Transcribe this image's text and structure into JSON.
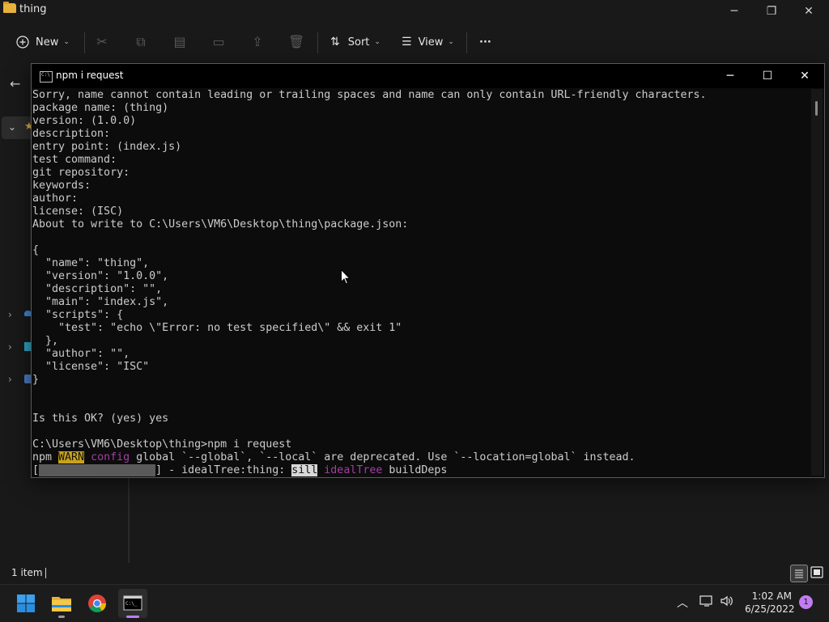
{
  "explorer": {
    "title": "thing",
    "toolbar": {
      "new_label": "New",
      "sort_label": "Sort",
      "view_label": "View",
      "more_label": "···"
    },
    "status": {
      "item_count": "1 item"
    }
  },
  "console": {
    "title": "npm i request",
    "lines": [
      "Sorry, name cannot contain leading or trailing spaces and name can only contain URL-friendly characters.",
      "package name: (thing)",
      "version: (1.0.0)",
      "description:",
      "entry point: (index.js)",
      "test command:",
      "git repository:",
      "keywords:",
      "author:",
      "license: (ISC)",
      "About to write to C:\\Users\\VM6\\Desktop\\thing\\package.json:",
      "",
      "{",
      "  \"name\": \"thing\",",
      "  \"version\": \"1.0.0\",",
      "  \"description\": \"\",",
      "  \"main\": \"index.js\",",
      "  \"scripts\": {",
      "    \"test\": \"echo \\\"Error: no test specified\\\" && exit 1\"",
      "  },",
      "  \"author\": \"\",",
      "  \"license\": \"ISC\"",
      "}",
      "",
      "",
      "Is this OK? (yes) yes",
      "",
      "C:\\Users\\VM6\\Desktop\\thing>npm i request"
    ],
    "warn_line": {
      "prefix": "npm ",
      "level": "WARN",
      "sep": " ",
      "scope": "config",
      "message": " global `--global`, `--local` are deprecated. Use `--location=global` instead."
    },
    "progress_line": {
      "open": "[",
      "bar": "##################",
      "close": "] - idealTree:thing: ",
      "level": "sill",
      "sep": " ",
      "scope": "idealTree",
      "message": " buildDeps"
    }
  },
  "taskbar": {
    "time": "1:02 AM",
    "date": "6/25/2022",
    "notification_count": "1"
  },
  "colors": {
    "console_bg": "#0c0c0c",
    "console_text": "#cccccc",
    "warn_bg": "#c9a21a",
    "magenta": "#a23fa0",
    "explorer_bg": "#191919",
    "taskbar_bg": "#1c1c1c",
    "accent": "#0078d4"
  }
}
